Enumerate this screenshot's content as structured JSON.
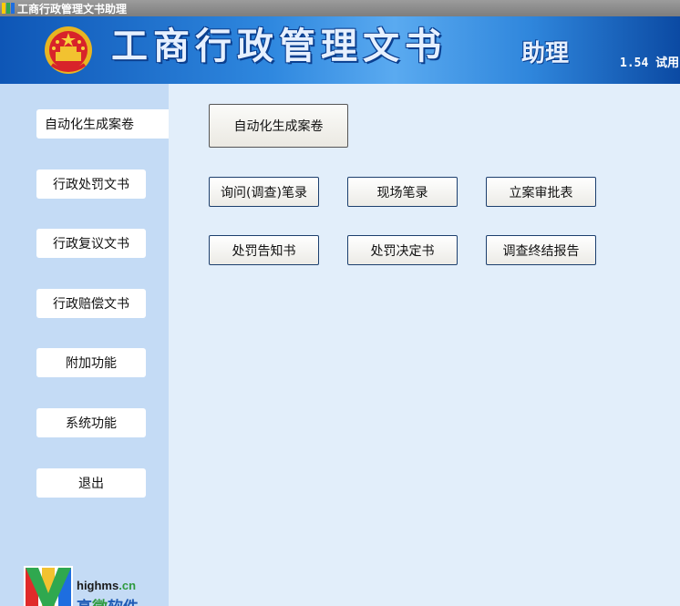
{
  "window": {
    "title": "工商行政管理文书助理"
  },
  "header": {
    "title": "工商行政管理文书",
    "subtitle": "助理",
    "version": "1.54 试用"
  },
  "sidebar": {
    "items": [
      {
        "label": "自动化生成案卷",
        "active": true
      },
      {
        "label": "行政处罚文书"
      },
      {
        "label": "行政复议文书"
      },
      {
        "label": "行政赔偿文书"
      },
      {
        "label": "附加功能"
      },
      {
        "label": "系统功能"
      },
      {
        "label": "退出"
      }
    ],
    "logo": {
      "domain": "highms",
      "domain_suffix": ".cn",
      "brand_a": "高",
      "brand_b": "微",
      "brand_c": "软件"
    }
  },
  "main": {
    "primary_button": "自动化生成案卷",
    "buttons": [
      "询问(调查)笔录",
      "现场笔录",
      "立案审批表",
      "处罚告知书",
      "处罚决定书",
      "调查终结报告"
    ]
  },
  "colors": {
    "accent": "#1c3f6e",
    "sidebar": "#c4dbf5",
    "content": "#e2eefa",
    "header": "#2f88df"
  }
}
